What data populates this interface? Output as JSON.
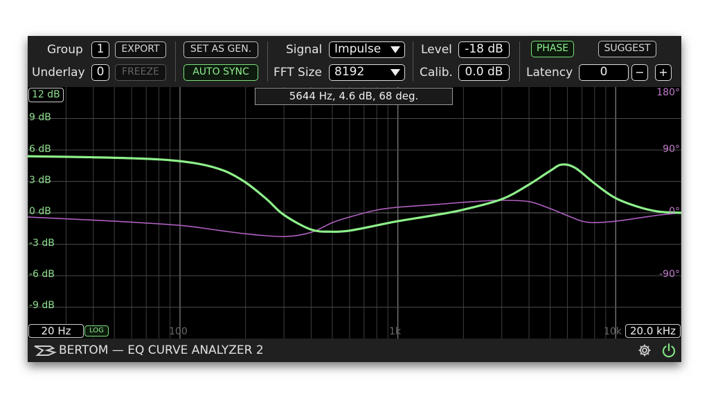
{
  "controls": {
    "group_label": "Group",
    "group_value": "1",
    "export_label": "EXPORT",
    "underlay_label": "Underlay",
    "underlay_value": "0",
    "freeze_label": "FREEZE",
    "set_as_gen_label": "SET AS GEN.",
    "auto_sync_label": "AUTO SYNC",
    "signal_label": "Signal",
    "signal_value": "Impulse",
    "fft_label": "FFT Size",
    "fft_value": "8192",
    "level_label": "Level",
    "level_value": "-18 dB",
    "calib_label": "Calib.",
    "calib_value": "0.0 dB",
    "phase_label": "PHASE",
    "suggest_label": "SUGGEST",
    "latency_label": "Latency",
    "latency_value": "0",
    "minus_label": "−",
    "plus_label": "+"
  },
  "graph": {
    "range_label": "12 dB",
    "readout": "5644 Hz, 4.6 dB, 68 deg.",
    "db_labels": [
      "9 dB",
      "6 dB",
      "3 dB",
      "0 dB",
      "-3 dB",
      "-6 dB",
      "-9 dB"
    ],
    "phase_labels": [
      "180°",
      "90°",
      "0°",
      "-90°"
    ],
    "freq_labels": [
      "100",
      "1k",
      "10k"
    ],
    "min_freq": "20 Hz",
    "max_freq": "20.0 kHz",
    "log_label": "LOG"
  },
  "chart_data": {
    "type": "line",
    "xlim": [
      20,
      20000
    ],
    "ylim": [
      -12,
      12
    ],
    "y2lim": [
      -180,
      180
    ],
    "grid": true,
    "series": [
      {
        "color": "#8ef08a",
        "axis": "db",
        "x": [
          20,
          40,
          80,
          120,
          160,
          200,
          250,
          300,
          400,
          500,
          600,
          800,
          1000,
          1500,
          2000,
          3000,
          4000,
          5000,
          5644,
          6500,
          8000,
          10000,
          13000,
          16000,
          20000
        ],
        "y": [
          5.4,
          5.3,
          5.1,
          4.7,
          4.0,
          2.9,
          1.3,
          -0.2,
          -1.6,
          -1.8,
          -1.7,
          -1.2,
          -0.8,
          -0.2,
          0.3,
          1.3,
          2.7,
          4.0,
          4.6,
          4.3,
          2.8,
          1.4,
          0.5,
          0.1,
          0
        ]
      },
      {
        "color": "#b060c0",
        "axis": "phase",
        "x": [
          20,
          50,
          100,
          150,
          200,
          300,
          400,
          500,
          600,
          800,
          1000,
          1500,
          2000,
          2500,
          3000,
          4000,
          5000,
          6000,
          7000,
          8000,
          10000,
          13000,
          16000,
          20000
        ],
        "y": [
          -6,
          -12,
          -18,
          -25,
          -30,
          -34,
          -28,
          -14,
          -6,
          4,
          8,
          12,
          15,
          17,
          18,
          16,
          6,
          -4,
          -12,
          -14,
          -12,
          -7,
          -3,
          0
        ]
      }
    ]
  },
  "footer": {
    "title": "BERTOM — EQ CURVE ANALYZER 2"
  },
  "colors": {
    "accent_green": "#8ef08a",
    "phase_purple": "#b060c0",
    "db_label": "#8fe08f",
    "phase_label": "#c07ac8"
  }
}
